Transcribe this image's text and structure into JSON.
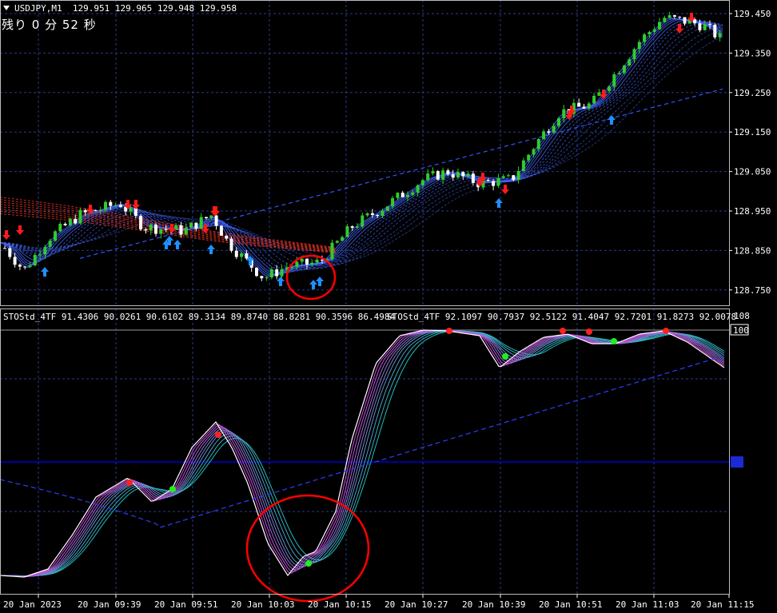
{
  "header": {
    "symbol": "USDJPY,M1",
    "ohlc": "129.951 129.965 129.948 129.958",
    "timer": "残り 0 分 52 秒"
  },
  "price_axis": {
    "ticks": [
      "129.450",
      "129.350",
      "129.250",
      "129.150",
      "129.050",
      "128.950",
      "128.850",
      "128.750"
    ]
  },
  "indicator": {
    "label_1": "STOStd_4TF 91.4306 90.0261 90.6102 89.3134 89.8740 88.8281 90.3596 86.4984",
    "label_2": "STOStd_4TF 92.1097 90.7937 92.5122 91.4047 92.7201 91.8273 92.0078",
    "axis_max": "108",
    "axis_level": "100"
  },
  "time_axis": {
    "ticks": [
      "20 Jan 2023",
      "20 Jan 09:39",
      "20 Jan 09:51",
      "20 Jan 10:03",
      "20 Jan 10:15",
      "20 Jan 10:27",
      "20 Jan 10:39",
      "20 Jan 10:51",
      "20 Jan 11:03",
      "20 Jan 11:15"
    ]
  },
  "colors": {
    "background": "#000000",
    "grid": "#2a3a8a",
    "bull": "#2ecc2e",
    "bear": "#ffffff",
    "sell_arrow": "#ff1a1a",
    "buy_arrow": "#1e90ff",
    "circle": "#ff0000",
    "mid_line": "#0000ff"
  }
}
